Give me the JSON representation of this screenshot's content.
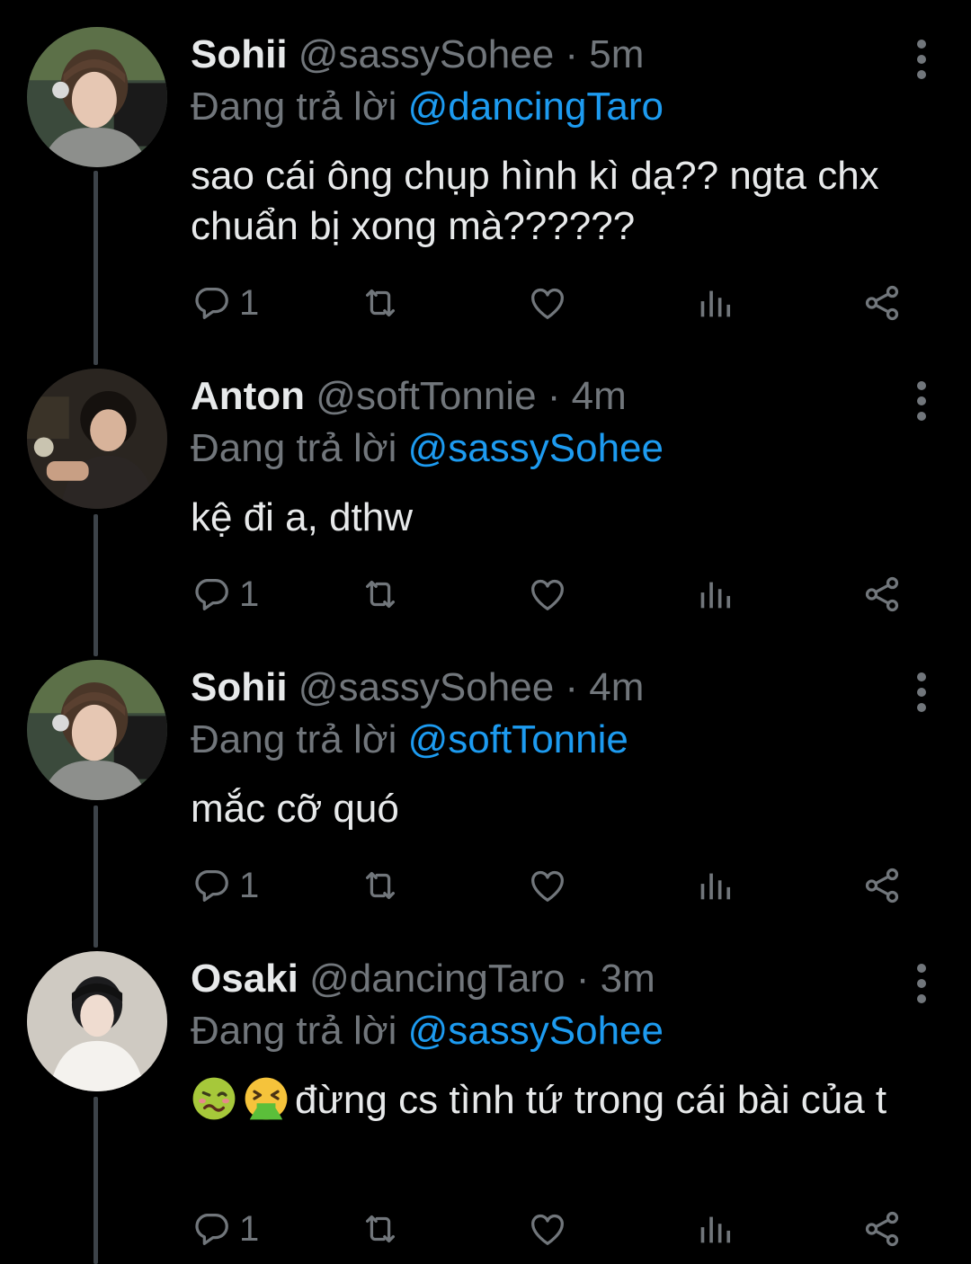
{
  "reply_prefix": "Đang trả lời",
  "separator": "·",
  "colors": {
    "background": "#000000",
    "text": "#e7e9ea",
    "muted": "#71767b",
    "link": "#1d9bf0",
    "thread_line": "#3d4349"
  },
  "tweets": [
    {
      "name": "Sohii",
      "handle": "@sassySohee",
      "time": "5m",
      "reply_to": "@dancingTaro",
      "text": "sao cái ông chụp hình kì dạ?? ngta chx chuẩn bị xong mà??????",
      "avatar_icon": "user-avatar-sohii",
      "actions": {
        "reply_count": "1",
        "retweet_count": "",
        "like_count": ""
      }
    },
    {
      "name": "Anton",
      "handle": "@softTonnie",
      "time": "4m",
      "reply_to": "@sassySohee",
      "text": "kệ đi a, dthw",
      "avatar_icon": "user-avatar-anton",
      "actions": {
        "reply_count": "1",
        "retweet_count": "",
        "like_count": ""
      }
    },
    {
      "name": "Sohii",
      "handle": "@sassySohee",
      "time": "4m",
      "reply_to": "@softTonnie",
      "text": "mắc cỡ quó",
      "avatar_icon": "user-avatar-sohii",
      "actions": {
        "reply_count": "1",
        "retweet_count": "",
        "like_count": ""
      }
    },
    {
      "name": "Osaki",
      "handle": "@dancingTaro",
      "time": "3m",
      "reply_to": "@sassySohee",
      "emojis": [
        "woozy-face-icon",
        "vomiting-face-icon"
      ],
      "text": "đừng cs tình tứ trong cái bài của t",
      "avatar_icon": "user-avatar-osaki",
      "actions": {
        "reply_count": "1",
        "retweet_count": "",
        "like_count": ""
      }
    }
  ]
}
